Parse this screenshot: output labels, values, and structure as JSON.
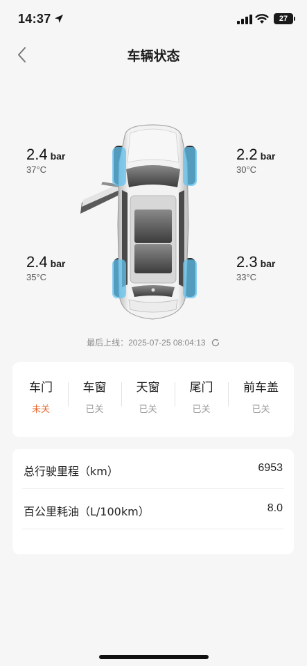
{
  "status_bar": {
    "time": "14:37",
    "battery": "27"
  },
  "nav": {
    "title": "车辆状态",
    "back_icon": "chevron-left-icon"
  },
  "tires": {
    "front_left": {
      "pressure": "2.4",
      "unit": "bar",
      "temp": "37°C"
    },
    "front_right": {
      "pressure": "2.2",
      "unit": "bar",
      "temp": "30°C"
    },
    "rear_left": {
      "pressure": "2.4",
      "unit": "bar",
      "temp": "35°C"
    },
    "rear_right": {
      "pressure": "2.3",
      "unit": "bar",
      "temp": "33°C"
    }
  },
  "last_online": {
    "label": "最后上线：",
    "timestamp": "2025-07-25 08:04:13"
  },
  "status_items": [
    {
      "name": "车门",
      "value": "未关",
      "state": "warn"
    },
    {
      "name": "车窗",
      "value": "已关",
      "state": "ok"
    },
    {
      "name": "天窗",
      "value": "已关",
      "state": "ok"
    },
    {
      "name": "尾门",
      "value": "已关",
      "state": "ok"
    },
    {
      "name": "前车盖",
      "value": "已关",
      "state": "ok"
    }
  ],
  "stats": [
    {
      "label": "总行驶里程（km）",
      "value": "6953"
    },
    {
      "label": "百公里耗油（L/100km）",
      "value": "8.0"
    }
  ],
  "colors": {
    "warn": "#e8692f",
    "tire_highlight": "#63c3f0",
    "background": "#f6f6f6"
  }
}
